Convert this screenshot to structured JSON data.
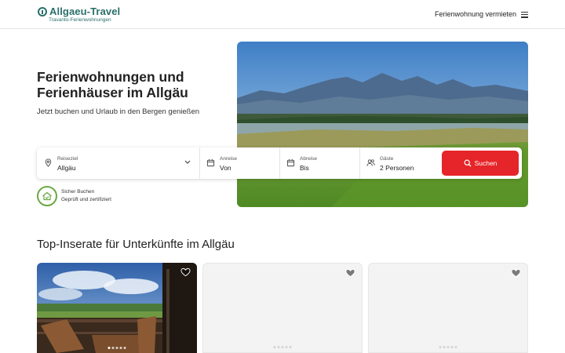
{
  "header": {
    "logo_title": "Allgaeu-Travel",
    "logo_subtitle": "Travanto-Ferienwohnungen",
    "host_link": "Ferienwohnung vermieten",
    "menu_icon": "hamburger-menu-icon"
  },
  "hero": {
    "title_line1": "Ferienwohnungen und",
    "title_line2": "Ferienhäuser im Allgäu",
    "subtitle": "Jetzt buchen und Urlaub in den Bergen genießen"
  },
  "search": {
    "destination_label": "Reiseziel",
    "destination_value": "Allgäu",
    "arrival_label": "Anreise",
    "arrival_value": "Von",
    "departure_label": "Abreise",
    "departure_value": "Bis",
    "guests_label": "Gäste",
    "guests_value": "2 Personen",
    "button_label": "Suchen",
    "button_color": "#e52529"
  },
  "trust": {
    "title": "Sicher Buchen",
    "subtitle": "Geprüft und zertifiziert"
  },
  "listings": {
    "title": "Top-Inserate für Unterkünfte im Allgäu"
  },
  "colors": {
    "brand": "#2a6f6a",
    "accent": "#e52529",
    "trust_green": "#6aa843"
  }
}
